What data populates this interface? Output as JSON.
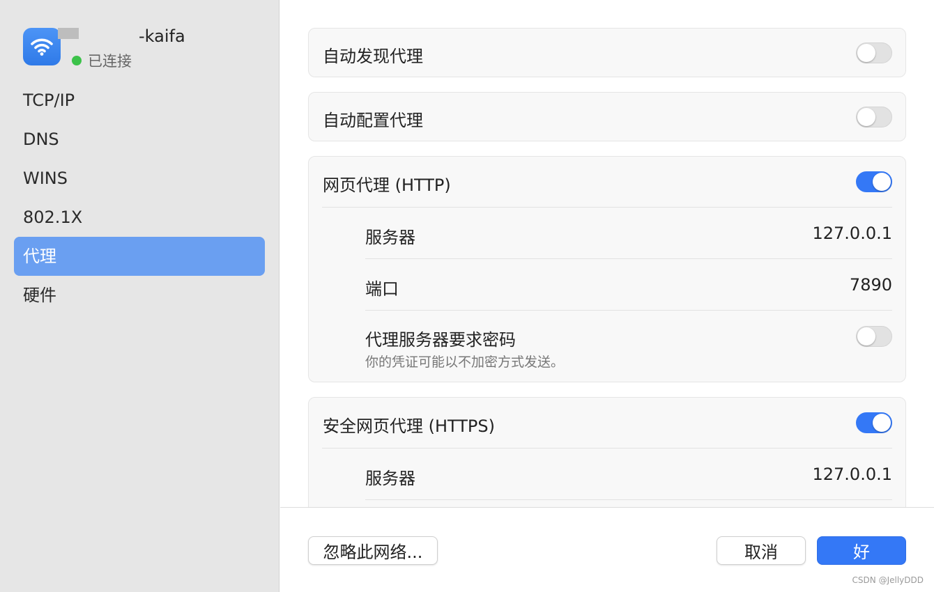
{
  "sidebar": {
    "network_name": "-kaifa",
    "status": "已连接",
    "status_color": "#3cc24a",
    "wifi_icon": "wifi-icon",
    "items": [
      {
        "label": "TCP/IP"
      },
      {
        "label": "DNS"
      },
      {
        "label": "WINS"
      },
      {
        "label": "802.1X"
      },
      {
        "label": "代理",
        "selected": true
      },
      {
        "label": "硬件"
      }
    ]
  },
  "proxies": {
    "auto_discovery": {
      "label": "自动发现代理",
      "enabled": false
    },
    "auto_config": {
      "label": "自动配置代理",
      "enabled": false
    },
    "http": {
      "label": "网页代理 (HTTP)",
      "enabled": true,
      "server_label": "服务器",
      "server": "127.0.0.1",
      "port_label": "端口",
      "port": "7890",
      "auth_label": "代理服务器要求密码",
      "auth_note": "你的凭证可能以不加密方式发送。",
      "auth_enabled": false
    },
    "https": {
      "label": "安全网页代理 (HTTPS)",
      "enabled": true,
      "server_label": "服务器",
      "server": "127.0.0.1"
    }
  },
  "footer": {
    "ignore_button": "忽略此网络...",
    "cancel_button": "取消",
    "ok_button": "好"
  },
  "watermark": "CSDN @JellyDDD",
  "colors": {
    "accent": "#3478f6",
    "sidebar_selected": "#6a9ff1"
  }
}
